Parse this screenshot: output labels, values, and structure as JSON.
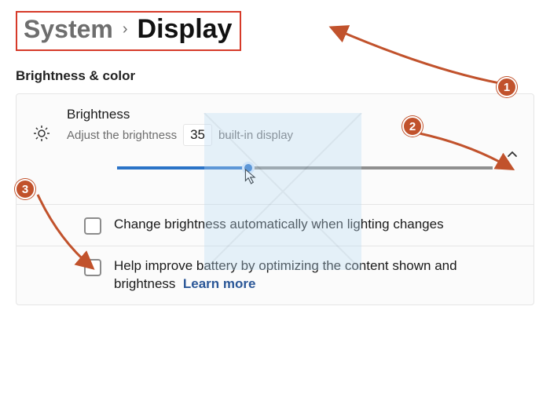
{
  "breadcrumb": {
    "parent": "System",
    "current": "Display"
  },
  "section": {
    "heading": "Brightness & color"
  },
  "brightness": {
    "title": "Brightness",
    "subtitle_prefix": "Adjust the brightness",
    "value": "35",
    "subtitle_suffix": "built-in display",
    "slider_percent": 35
  },
  "auto_brightness": {
    "label": "Change brightness automatically when lighting changes",
    "checked": false
  },
  "battery_opt": {
    "label": "Help improve battery by optimizing the content shown and brightness",
    "link_text": "Learn more",
    "checked": false
  },
  "callouts": {
    "c1": "1",
    "c2": "2",
    "c3": "3"
  },
  "colors": {
    "accent": "#2b73c7",
    "callout": "#c1522c",
    "highlight_border": "#d63a29"
  }
}
